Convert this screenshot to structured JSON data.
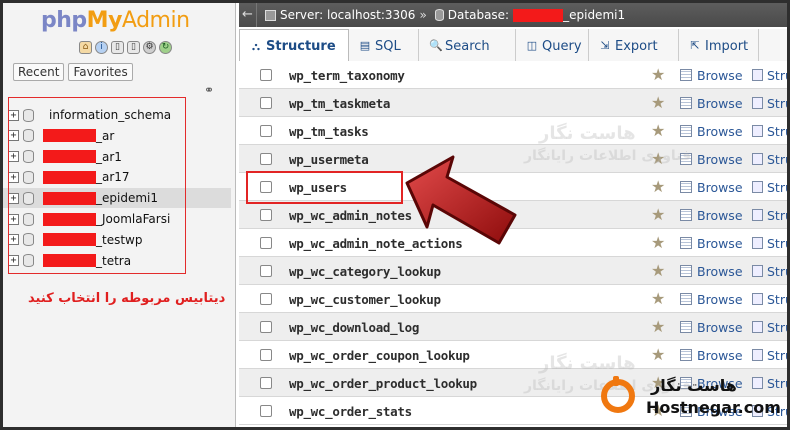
{
  "logo": {
    "php": "php",
    "my": "My",
    "admin": "Admin"
  },
  "sidebar": {
    "tabs": [
      "Recent",
      "Favorites"
    ],
    "databases": [
      {
        "prefix_redacted": false,
        "label": "information_schema"
      },
      {
        "prefix_redacted": true,
        "label": "_ar"
      },
      {
        "prefix_redacted": true,
        "label": "_ar1"
      },
      {
        "prefix_redacted": true,
        "label": "_ar17"
      },
      {
        "prefix_redacted": true,
        "label": "_epidemi1",
        "selected": true
      },
      {
        "prefix_redacted": true,
        "label": "_JoomlaFarsi"
      },
      {
        "prefix_redacted": true,
        "label": "_testwp"
      },
      {
        "prefix_redacted": true,
        "label": "_tetra"
      }
    ],
    "note": "دیتابیس مربوطه را انتخاب کنید"
  },
  "topbar": {
    "server_label": "Server: localhost:3306",
    "separator": "»",
    "database_label": "Database:",
    "database_suffix": "_epidemi1"
  },
  "tabs": [
    {
      "label": "Structure",
      "glyph": "⛬",
      "active": true
    },
    {
      "label": "SQL",
      "glyph": "▤"
    },
    {
      "label": "Search",
      "glyph": "🔍"
    },
    {
      "label": "Query",
      "glyph": "◫"
    },
    {
      "label": "Export",
      "glyph": "⇲"
    },
    {
      "label": "Import",
      "glyph": "⇱"
    }
  ],
  "tables": [
    "wp_term_taxonomy",
    "wp_tm_taskmeta",
    "wp_tm_tasks",
    "wp_usermeta",
    "wp_users",
    "wp_wc_admin_notes",
    "wp_wc_admin_note_actions",
    "wp_wc_category_lookup",
    "wp_wc_customer_lookup",
    "wp_wc_download_log",
    "wp_wc_order_coupon_lookup",
    "wp_wc_order_product_lookup",
    "wp_wc_order_stats"
  ],
  "row_actions": {
    "browse": "Browse",
    "structure": "Stru"
  },
  "watermark": {
    "fa1": "هاست نگار",
    "fa2": "فناوری اطلاعات رایانگار"
  },
  "brand": {
    "fa": "هاست نگار",
    "en": "Hostnegar.com",
    "color": "#f07810"
  },
  "colors": {
    "highlight": "#e22424",
    "redaction": "#f31a1a",
    "accent": "#1d4c86"
  }
}
